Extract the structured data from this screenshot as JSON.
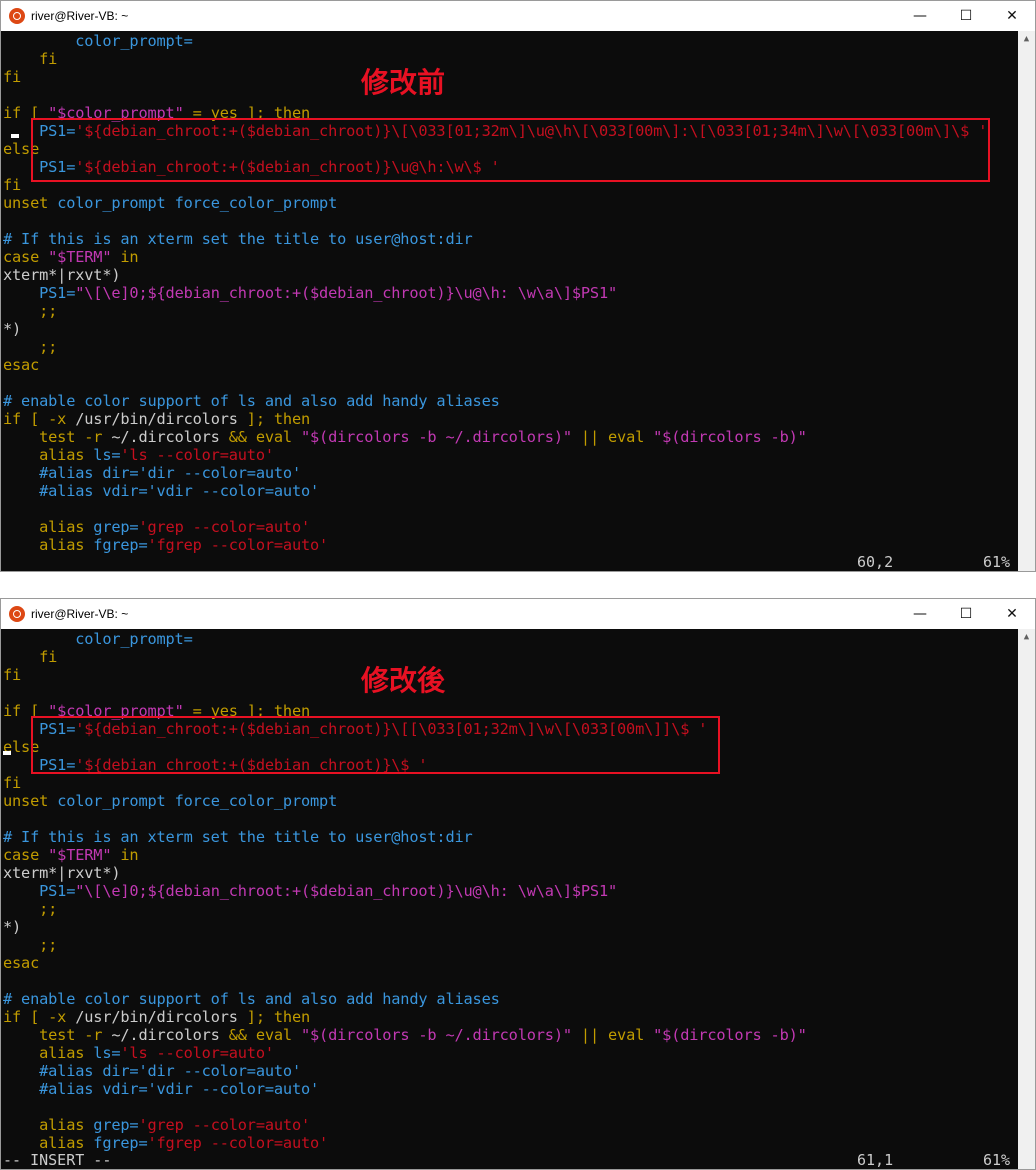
{
  "windows": [
    {
      "title": "river@River-VB: ~",
      "annotation": "修改前",
      "position": "60,2",
      "percent": "61%",
      "mode": "",
      "lines": [
        [
          {
            "t": "        color_prompt=",
            "c": "cy"
          }
        ],
        [
          {
            "t": "    fi",
            "c": "yl"
          }
        ],
        [
          {
            "t": "fi",
            "c": "yl"
          }
        ],
        [],
        [
          {
            "t": "if [ ",
            "c": "yl"
          },
          {
            "t": "\"$color_prompt\"",
            "c": "mg"
          },
          {
            "t": " = yes ]; then",
            "c": "yl"
          }
        ],
        [
          {
            "t": "    PS1=",
            "c": "cy"
          },
          {
            "t": "'${debian_chroot:+($debian_chroot)}\\[\\033[01;32m\\]\\u@\\h\\[\\033[00m\\]:\\[\\033[01;34m\\]\\w\\[\\033[00m\\]\\$ '",
            "c": "rd"
          }
        ],
        [
          {
            "t": "else",
            "c": "yl"
          }
        ],
        [
          {
            "t": "    PS1=",
            "c": "cy"
          },
          {
            "t": "'${debian_chroot:+($debian_chroot)}\\u@\\h:\\w\\$ '",
            "c": "rd"
          }
        ],
        [
          {
            "t": "fi",
            "c": "yl"
          }
        ],
        [
          {
            "t": "unset ",
            "c": "yl"
          },
          {
            "t": "color_prompt force_color_prompt",
            "c": "cy"
          }
        ],
        [],
        [
          {
            "t": "# If this is an xterm set the title to user@host:dir",
            "c": "tl"
          }
        ],
        [
          {
            "t": "case ",
            "c": "yl"
          },
          {
            "t": "\"$TERM\"",
            "c": "mg"
          },
          {
            "t": " in",
            "c": "yl"
          }
        ],
        [
          {
            "t": "xterm*|rxvt*)",
            "c": "wh"
          }
        ],
        [
          {
            "t": "    PS1=",
            "c": "cy"
          },
          {
            "t": "\"\\[\\e]0;${debian_chroot:+($debian_chroot)}\\u@\\h: \\w\\a\\]$PS1\"",
            "c": "mg"
          }
        ],
        [
          {
            "t": "    ;;",
            "c": "yl"
          }
        ],
        [
          {
            "t": "*)",
            "c": "wh"
          }
        ],
        [
          {
            "t": "    ;;",
            "c": "yl"
          }
        ],
        [
          {
            "t": "esac",
            "c": "yl"
          }
        ],
        [],
        [
          {
            "t": "# enable color support of ls and also add handy aliases",
            "c": "tl"
          }
        ],
        [
          {
            "t": "if [ -x ",
            "c": "yl"
          },
          {
            "t": "/usr/bin/dircolors",
            "c": "wh"
          },
          {
            "t": " ]; then",
            "c": "yl"
          }
        ],
        [
          {
            "t": "    test -r ",
            "c": "yl"
          },
          {
            "t": "~/.dircolors ",
            "c": "wh"
          },
          {
            "t": "&& eval ",
            "c": "yl"
          },
          {
            "t": "\"$(dircolors -b ~/.dircolors)\"",
            "c": "mg"
          },
          {
            "t": " || eval ",
            "c": "yl"
          },
          {
            "t": "\"$(dircolors -b)\"",
            "c": "mg"
          }
        ],
        [
          {
            "t": "    alias ",
            "c": "yl"
          },
          {
            "t": "ls=",
            "c": "cy"
          },
          {
            "t": "'ls --color=auto'",
            "c": "rd"
          }
        ],
        [
          {
            "t": "    #alias dir='dir --color=auto'",
            "c": "tl"
          }
        ],
        [
          {
            "t": "    #alias vdir='vdir --color=auto'",
            "c": "tl"
          }
        ],
        [],
        [
          {
            "t": "    alias ",
            "c": "yl"
          },
          {
            "t": "grep=",
            "c": "cy"
          },
          {
            "t": "'grep --color=auto'",
            "c": "rd"
          }
        ],
        [
          {
            "t": "    alias ",
            "c": "yl"
          },
          {
            "t": "fgrep=",
            "c": "cy"
          },
          {
            "t": "'fgrep --color=auto'",
            "c": "rd"
          }
        ]
      ]
    },
    {
      "title": "river@River-VB: ~",
      "annotation": "修改後",
      "position": "61,1",
      "percent": "61%",
      "mode": "-- INSERT --",
      "lines": [
        [
          {
            "t": "        color_prompt=",
            "c": "cy"
          }
        ],
        [
          {
            "t": "    fi",
            "c": "yl"
          }
        ],
        [
          {
            "t": "fi",
            "c": "yl"
          }
        ],
        [],
        [
          {
            "t": "if [ ",
            "c": "yl"
          },
          {
            "t": "\"$color_prompt\"",
            "c": "mg"
          },
          {
            "t": " = yes ]; then",
            "c": "yl"
          }
        ],
        [
          {
            "t": "    PS1=",
            "c": "cy"
          },
          {
            "t": "'${debian_chroot:+($debian_chroot)}\\[[\\033[01;32m\\]\\w\\[\\033[00m\\]]\\$ '",
            "c": "rd"
          }
        ],
        [
          {
            "t": "else",
            "c": "yl"
          }
        ],
        [
          {
            "t": "    PS1=",
            "c": "cy"
          },
          {
            "t": "'${debian_chroot:+($debian_chroot)}\\$ '",
            "c": "rd"
          }
        ],
        [
          {
            "t": "fi",
            "c": "yl"
          }
        ],
        [
          {
            "t": "unset ",
            "c": "yl"
          },
          {
            "t": "color_prompt force_color_prompt",
            "c": "cy"
          }
        ],
        [],
        [
          {
            "t": "# If this is an xterm set the title to user@host:dir",
            "c": "tl"
          }
        ],
        [
          {
            "t": "case ",
            "c": "yl"
          },
          {
            "t": "\"$TERM\"",
            "c": "mg"
          },
          {
            "t": " in",
            "c": "yl"
          }
        ],
        [
          {
            "t": "xterm*|rxvt*)",
            "c": "wh"
          }
        ],
        [
          {
            "t": "    PS1=",
            "c": "cy"
          },
          {
            "t": "\"\\[\\e]0;${debian_chroot:+($debian_chroot)}\\u@\\h: \\w\\a\\]$PS1\"",
            "c": "mg"
          }
        ],
        [
          {
            "t": "    ;;",
            "c": "yl"
          }
        ],
        [
          {
            "t": "*)",
            "c": "wh"
          }
        ],
        [
          {
            "t": "    ;;",
            "c": "yl"
          }
        ],
        [
          {
            "t": "esac",
            "c": "yl"
          }
        ],
        [],
        [
          {
            "t": "# enable color support of ls and also add handy aliases",
            "c": "tl"
          }
        ],
        [
          {
            "t": "if [ -x ",
            "c": "yl"
          },
          {
            "t": "/usr/bin/dircolors",
            "c": "wh"
          },
          {
            "t": " ]; then",
            "c": "yl"
          }
        ],
        [
          {
            "t": "    test -r ",
            "c": "yl"
          },
          {
            "t": "~/.dircolors ",
            "c": "wh"
          },
          {
            "t": "&& eval ",
            "c": "yl"
          },
          {
            "t": "\"$(dircolors -b ~/.dircolors)\"",
            "c": "mg"
          },
          {
            "t": " || eval ",
            "c": "yl"
          },
          {
            "t": "\"$(dircolors -b)\"",
            "c": "mg"
          }
        ],
        [
          {
            "t": "    alias ",
            "c": "yl"
          },
          {
            "t": "ls=",
            "c": "cy"
          },
          {
            "t": "'ls --color=auto'",
            "c": "rd"
          }
        ],
        [
          {
            "t": "    #alias dir='dir --color=auto'",
            "c": "tl"
          }
        ],
        [
          {
            "t": "    #alias vdir='vdir --color=auto'",
            "c": "tl"
          }
        ],
        [],
        [
          {
            "t": "    alias ",
            "c": "yl"
          },
          {
            "t": "grep=",
            "c": "cy"
          },
          {
            "t": "'grep --color=auto'",
            "c": "rd"
          }
        ],
        [
          {
            "t": "    alias ",
            "c": "yl"
          },
          {
            "t": "fgrep=",
            "c": "cy"
          },
          {
            "t": "'fgrep --color=auto'",
            "c": "rd"
          }
        ]
      ]
    }
  ],
  "controls": {
    "minimize": "—",
    "maximize": "☐",
    "close": "✕"
  },
  "scroll_arrow": "▲"
}
